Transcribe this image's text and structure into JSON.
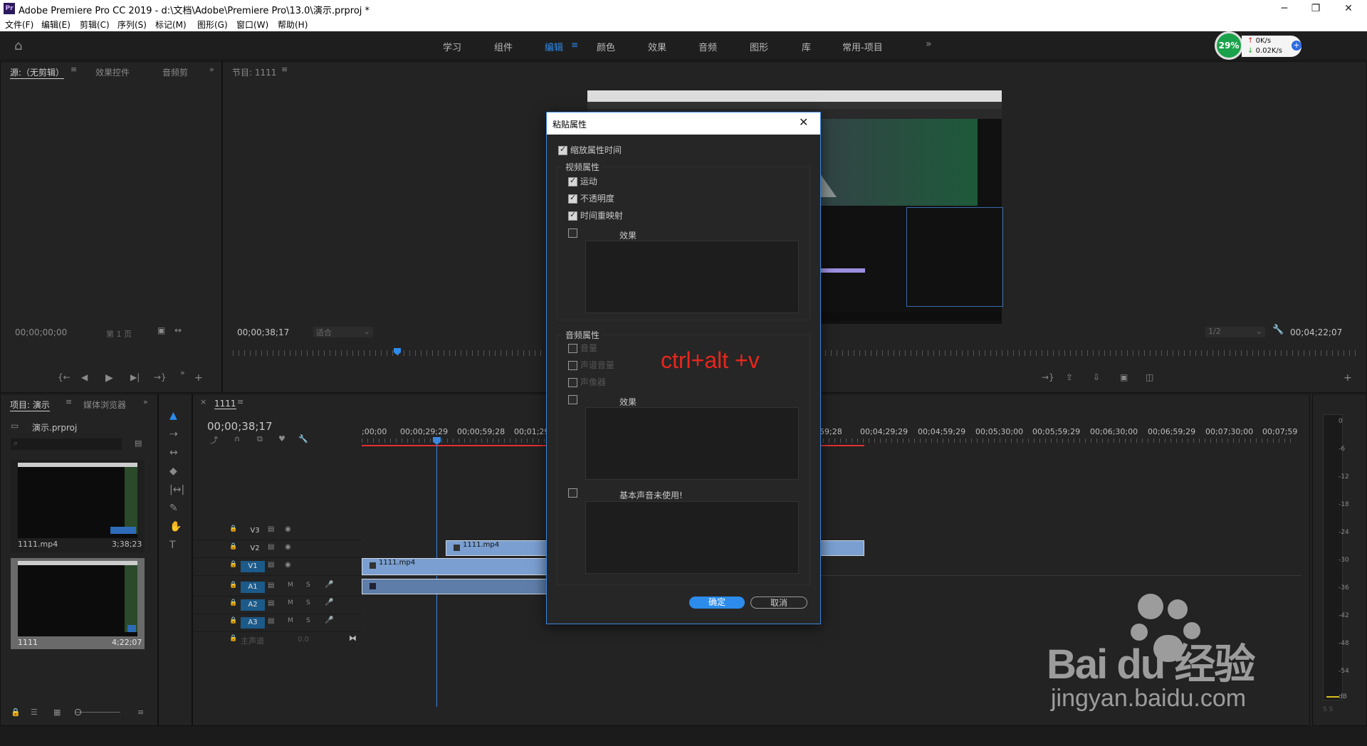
{
  "window": {
    "app_icon": "Pr",
    "title": "Adobe Premiere Pro CC 2019 - d:\\文档\\Adobe\\Premiere Pro\\13.0\\演示.prproj *",
    "controls": [
      "minimize-icon",
      "maximize-icon",
      "close-icon"
    ]
  },
  "menu": [
    "文件(F)",
    "编辑(E)",
    "剪辑(C)",
    "序列(S)",
    "标记(M)",
    "图形(G)",
    "窗口(W)",
    "帮助(H)"
  ],
  "workspaces": [
    "学习",
    "组件",
    "编辑",
    "颜色",
    "效果",
    "音频",
    "图形",
    "库",
    "常用-项目"
  ],
  "active_workspace": "编辑",
  "net_widget": {
    "percent": "29%",
    "up": "0K/s",
    "down": "0.02K/s"
  },
  "source_panel": {
    "tabs": [
      "源:（无剪辑）",
      "效果控件",
      "音频剪"
    ],
    "timecode": "00;00;00;00",
    "page": "第 1 页"
  },
  "program_panel": {
    "tab": "节目: 1111",
    "timecode_left": "00;00;38;17",
    "fit": "适合",
    "resolution": "1/2",
    "timecode_right": "00;04;22;07"
  },
  "project_panel": {
    "tabs": [
      "项目: 演示",
      "媒体浏览器"
    ],
    "project_name": "演示.prproj",
    "items": [
      {
        "name": "1111.mp4",
        "duration": "3;38;23"
      },
      {
        "name": "1111",
        "duration": "4;22;07"
      }
    ]
  },
  "timeline": {
    "tab": "1111",
    "timecode": "00;00;38;17",
    "ruler_labels": [
      ";00;00",
      "00;00;29;29",
      "00;00;59;28",
      "00;01;29",
      "59;28",
      "00;04;29;29",
      "00;04;59;29",
      "00;05;30;00",
      "00;05;59;29",
      "00;06;30;00",
      "00;06;59;29",
      "00;07;30;00",
      "00;07;59"
    ],
    "video_tracks": [
      "V3",
      "V2",
      "V1"
    ],
    "audio_tracks": [
      "A1",
      "A2",
      "A3"
    ],
    "master": {
      "label": "主声道",
      "value": "0.0"
    },
    "clips": [
      {
        "name": "1111.mp4"
      },
      {
        "name": "1111.mp4"
      }
    ]
  },
  "meter_labels": [
    "0",
    "-6",
    "-12",
    "-18",
    "-24",
    "-30",
    "-36",
    "-42",
    "-48",
    "-54",
    "dB"
  ],
  "meter_footer": "S S",
  "dialog": {
    "title": "粘贴属性",
    "scale_time": "缩放属性时间",
    "video_group": "视频属性",
    "video_items": [
      "运动",
      "不透明度",
      "时间重映射"
    ],
    "video_effects": "效果",
    "audio_group": "音频属性",
    "audio_items": [
      "音量",
      "声道音量",
      "声像器"
    ],
    "audio_effects": "效果",
    "essential_sound": "基本声音未使用!",
    "ok": "确定",
    "cancel": "取消"
  },
  "annotation": "ctrl+alt +v",
  "watermark": {
    "brand": "Bai du 经验",
    "url": "jingyan.baidu.com"
  },
  "colors": {
    "accent": "#2d8ceb",
    "clip": "#7a9fd0",
    "annotation": "#e8261c",
    "playhead": "#3a87e0"
  }
}
